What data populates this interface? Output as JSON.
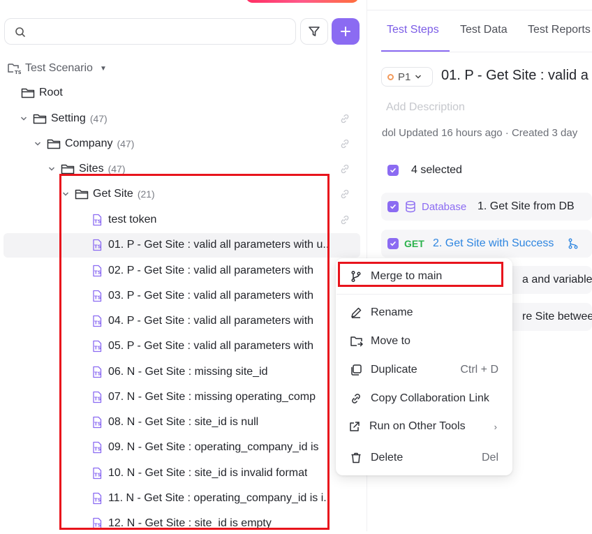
{
  "search": {
    "placeholder": ""
  },
  "tree": {
    "header": "Test Scenario",
    "root": "Root",
    "folders": [
      {
        "label": "Setting",
        "count": "(47)"
      },
      {
        "label": "Company",
        "count": "(47)"
      },
      {
        "label": "Sites",
        "count": "(47)"
      },
      {
        "label": "Get Site",
        "count": "(21)"
      }
    ],
    "cases": [
      "test token",
      "01. P - Get Site : valid all parameters with u...",
      "02. P - Get Site : valid all parameters with",
      "03. P - Get Site : valid all parameters with",
      "04. P - Get Site : valid all parameters with",
      "05. P - Get Site : valid all parameters with",
      "06. N - Get Site : missing site_id",
      "07. N - Get Site : missing operating_comp",
      "08. N - Get Site : site_id is null",
      "09. N - Get Site : operating_company_id is",
      "10. N - Get Site : site_id is invalid format",
      "11. N - Get Site : operating_company_id is i...",
      "12. N - Get Site : site_id is empty"
    ]
  },
  "tabs": [
    "Test Steps",
    "Test Data",
    "Test Reports"
  ],
  "detail": {
    "priority": "P1",
    "title": "01. P - Get Site : valid a",
    "description_placeholder": "Add Description",
    "meta": "dol Updated 16 hours ago · Created 3 day",
    "selected": "4 selected",
    "steps": [
      {
        "badge": "Database",
        "label": "1. Get Site from DB"
      },
      {
        "badge": "GET",
        "label": "2. Get Site with Success"
      },
      {
        "badge": "",
        "label": "a and variables"
      },
      {
        "badge": "",
        "label": "re Site betweer"
      }
    ]
  },
  "menu": {
    "merge": "Merge to main",
    "rename": "Rename",
    "move": "Move to",
    "duplicate": "Duplicate",
    "duplicate_shortcut": "Ctrl + D",
    "copy_link": "Copy Collaboration Link",
    "run_other": "Run on Other Tools",
    "delete": "Delete",
    "delete_shortcut": "Del"
  },
  "colors": {
    "accent": "#8b6bf2",
    "highlight": "#e8141c",
    "get": "#2bb24c"
  }
}
